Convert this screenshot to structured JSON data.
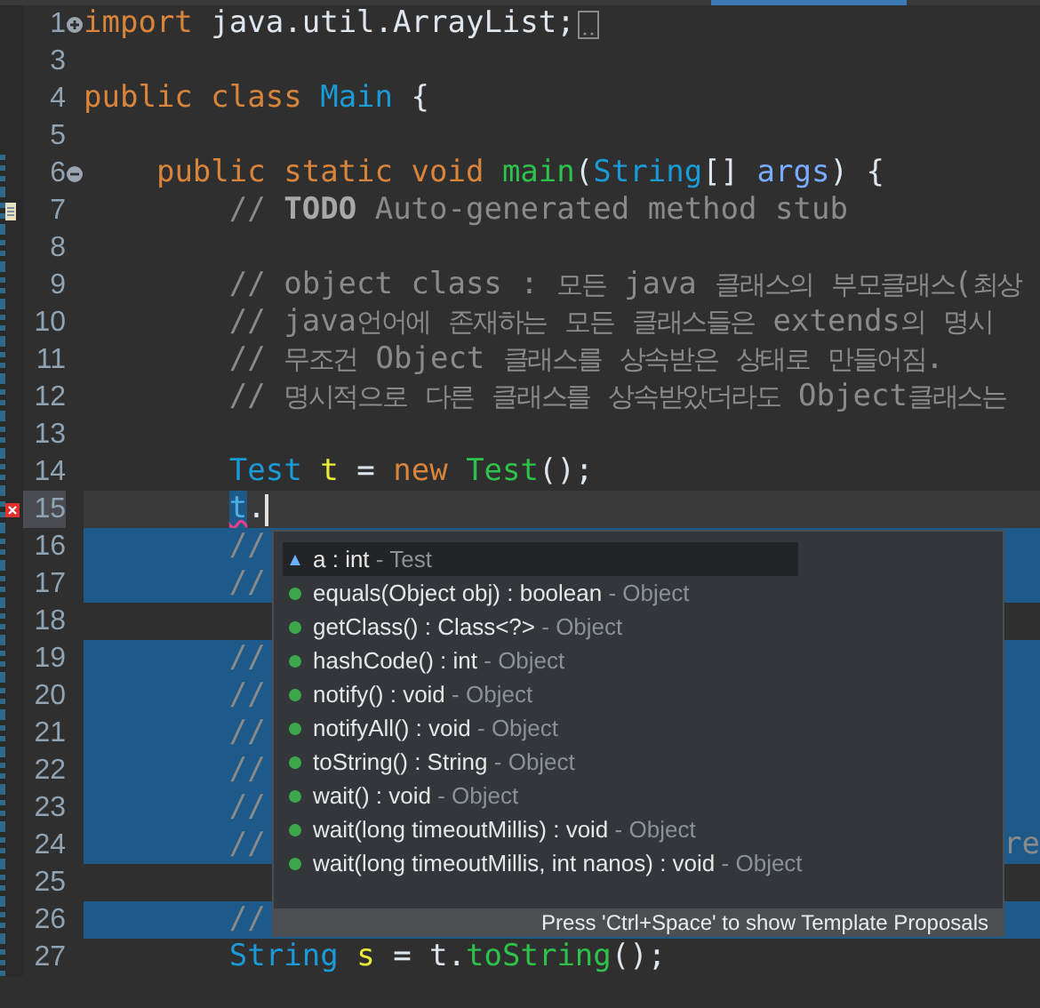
{
  "lines": [
    {
      "number": "1",
      "fold": {
        "kind": "expand"
      },
      "tokens": [
        {
          "text": "import",
          "kind": "keyword"
        },
        {
          "text": " java.util.ArrayList;",
          "kind": "plain"
        }
      ],
      "folded_marker": true,
      "selected": false,
      "current": false
    },
    {
      "number": "3",
      "selected": false,
      "current": false
    },
    {
      "number": "4",
      "tokens": [
        {
          "text": "public class ",
          "kind": "keyword"
        },
        {
          "text": "Main",
          "kind": "type"
        },
        {
          "text": " {",
          "kind": "plain"
        }
      ],
      "selected": false,
      "current": false
    },
    {
      "number": "5",
      "selected": false,
      "current": false
    },
    {
      "number": "6",
      "fold": {
        "kind": "collapse"
      },
      "tokens": [
        {
          "text": "    public static void ",
          "kind": "keyword"
        },
        {
          "text": "main",
          "kind": "method"
        },
        {
          "text": "(",
          "kind": "plain"
        },
        {
          "text": "String",
          "kind": "type"
        },
        {
          "text": "[] ",
          "kind": "plain"
        },
        {
          "text": "args",
          "kind": "param"
        },
        {
          "text": ") {",
          "kind": "plain"
        }
      ],
      "selected": false,
      "current": false
    },
    {
      "number": "7",
      "marker": {
        "kind": "task"
      },
      "tokens": [
        {
          "text": "        // ",
          "kind": "comment"
        },
        {
          "text": "TODO",
          "kind": "todo"
        },
        {
          "text": " Auto-generated method stub",
          "kind": "comment"
        }
      ],
      "selected": false,
      "current": false
    },
    {
      "number": "8",
      "selected": false,
      "current": false
    },
    {
      "number": "9",
      "tokens": [
        {
          "text": "        // object class : 모든 java 클래스의 부모클래스(최상",
          "kind": "comment"
        }
      ],
      "selected": false,
      "current": false
    },
    {
      "number": "10",
      "tokens": [
        {
          "text": "        // java언어에 존재하는 모든 클래스들은 extends의 명시",
          "kind": "comment"
        }
      ],
      "selected": false,
      "current": false
    },
    {
      "number": "11",
      "tokens": [
        {
          "text": "        // 무조건 Object 클래스를 상속받은 상태로 만들어짐.",
          "kind": "comment"
        }
      ],
      "selected": false,
      "current": false
    },
    {
      "number": "12",
      "tokens": [
        {
          "text": "        // 명시적으로 다른 클래스를 상속받았더라도 Object클래스는",
          "kind": "comment"
        }
      ],
      "selected": false,
      "current": false
    },
    {
      "number": "13",
      "selected": false,
      "current": false
    },
    {
      "number": "14",
      "tokens": [
        {
          "text": "        Test",
          "kind": "type"
        },
        {
          "text": " t",
          "kind": "variable"
        },
        {
          "text": " = ",
          "kind": "plain"
        },
        {
          "text": "new ",
          "kind": "keyword"
        },
        {
          "text": "Test",
          "kind": "method"
        },
        {
          "text": "();",
          "kind": "plain"
        }
      ],
      "selected": false,
      "current": false
    },
    {
      "number": "15",
      "marker": {
        "kind": "error"
      },
      "tokens": [
        {
          "text": "        t",
          "kind": "error"
        },
        {
          "text": ".",
          "kind": "plain"
        }
      ],
      "selected": false,
      "current": true
    },
    {
      "number": "16",
      "tokens": [
        {
          "text": "        //",
          "kind": "comment"
        }
      ],
      "selected": true,
      "current": false
    },
    {
      "number": "17",
      "tokens": [
        {
          "text": "        //",
          "kind": "comment"
        }
      ],
      "selected": true,
      "current": false
    },
    {
      "number": "18",
      "selected": false,
      "current": false
    },
    {
      "number": "19",
      "tokens": [
        {
          "text": "        //",
          "kind": "comment"
        }
      ],
      "selected": true,
      "current": false
    },
    {
      "number": "20",
      "tokens": [
        {
          "text": "        //",
          "kind": "comment"
        }
      ],
      "selected": true,
      "current": false
    },
    {
      "number": "21",
      "tokens": [
        {
          "text": "        //",
          "kind": "comment"
        }
      ],
      "selected": true,
      "current": false
    },
    {
      "number": "22",
      "tokens": [
        {
          "text": "        //",
          "kind": "comment"
        }
      ],
      "selected": true,
      "current": false
    },
    {
      "number": "23",
      "tokens": [
        {
          "text": "        //",
          "kind": "comment"
        }
      ],
      "selected": true,
      "current": false
    },
    {
      "number": "24",
      "tokens": [
        {
          "text": "        //",
          "kind": "comment"
        }
      ],
      "tail": "re",
      "selected": true,
      "current": false
    },
    {
      "number": "25",
      "selected": false,
      "current": false
    },
    {
      "number": "26",
      "tokens": [
        {
          "text": "        //",
          "kind": "comment"
        }
      ],
      "selected": true,
      "current": false
    },
    {
      "number": "27",
      "tokens": [
        {
          "text": "        String",
          "kind": "type"
        },
        {
          "text": " s",
          "kind": "variable"
        },
        {
          "text": " = t.",
          "kind": "plain"
        },
        {
          "text": "toString",
          "kind": "method"
        },
        {
          "text": "();",
          "kind": "plain"
        }
      ],
      "selected": false,
      "current": false
    }
  ],
  "completion": {
    "items": [
      {
        "kind": "field",
        "signature": "a : int",
        "owner": "- Test",
        "selected": true
      },
      {
        "kind": "method",
        "signature": "equals(Object obj) : boolean",
        "owner": "- Object",
        "selected": false
      },
      {
        "kind": "method",
        "signature": "getClass() : Class<?>",
        "owner": "- Object",
        "selected": false
      },
      {
        "kind": "method",
        "signature": "hashCode() : int",
        "owner": "- Object",
        "selected": false
      },
      {
        "kind": "method",
        "signature": "notify() : void",
        "owner": "- Object",
        "selected": false
      },
      {
        "kind": "method",
        "signature": "notifyAll() : void",
        "owner": "- Object",
        "selected": false
      },
      {
        "kind": "method",
        "signature": "toString() : String",
        "owner": "- Object",
        "selected": false
      },
      {
        "kind": "method",
        "signature": "wait() : void",
        "owner": "- Object",
        "selected": false
      },
      {
        "kind": "method",
        "signature": "wait(long timeoutMillis) : void",
        "owner": "- Object",
        "selected": false
      },
      {
        "kind": "method",
        "signature": "wait(long timeoutMillis, int nanos) : void",
        "owner": "- Object",
        "selected": false
      }
    ],
    "footer": "Press 'Ctrl+Space' to show Template Proposals"
  }
}
